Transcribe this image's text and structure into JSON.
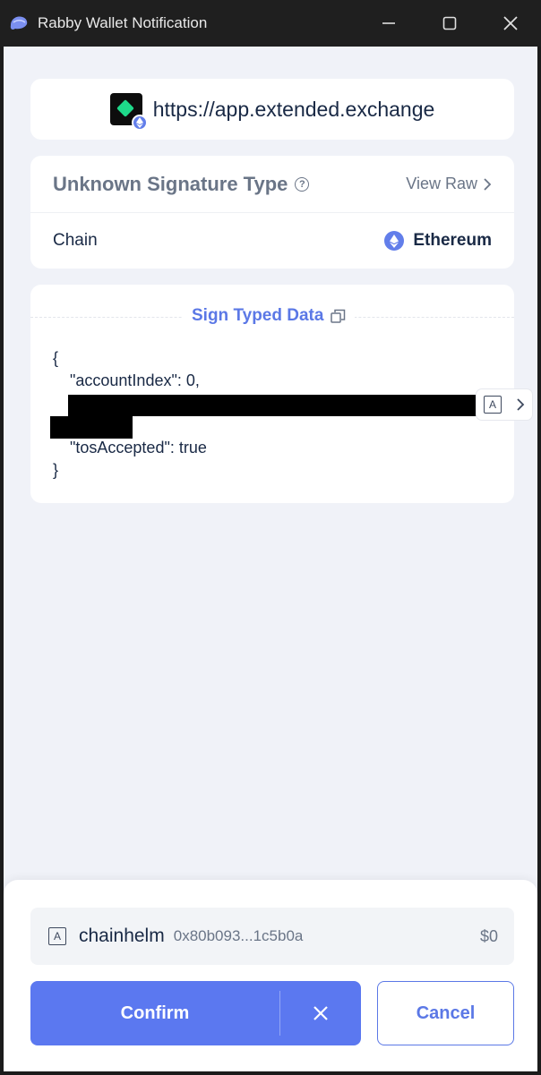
{
  "window": {
    "title": "Rabby Wallet Notification",
    "controls": [
      "minimize-icon",
      "maximize-icon",
      "close-icon"
    ]
  },
  "origin": {
    "url": "https://app.extended.exchange",
    "badge_icon": "ethereum-icon"
  },
  "signature": {
    "type_label": "Unknown Signature Type",
    "view_raw_label": "View Raw",
    "chain_label": "Chain",
    "chain_value": "Ethereum"
  },
  "typed_data": {
    "header": "Sign Typed Data",
    "lines": [
      "{",
      "\"accountIndex\": 0,",
      "\"tosAccepted\": true",
      "}"
    ]
  },
  "account": {
    "name": "chainhelm",
    "address": "0x80b093...1c5b0a",
    "balance": "$0",
    "avatar_letter": "A"
  },
  "actions": {
    "confirm_label": "Confirm",
    "cancel_label": "Cancel"
  },
  "colors": {
    "accent": "#5b78f0",
    "background": "#f0f2f8",
    "text_primary": "#192945",
    "text_secondary": "#6a7587"
  }
}
